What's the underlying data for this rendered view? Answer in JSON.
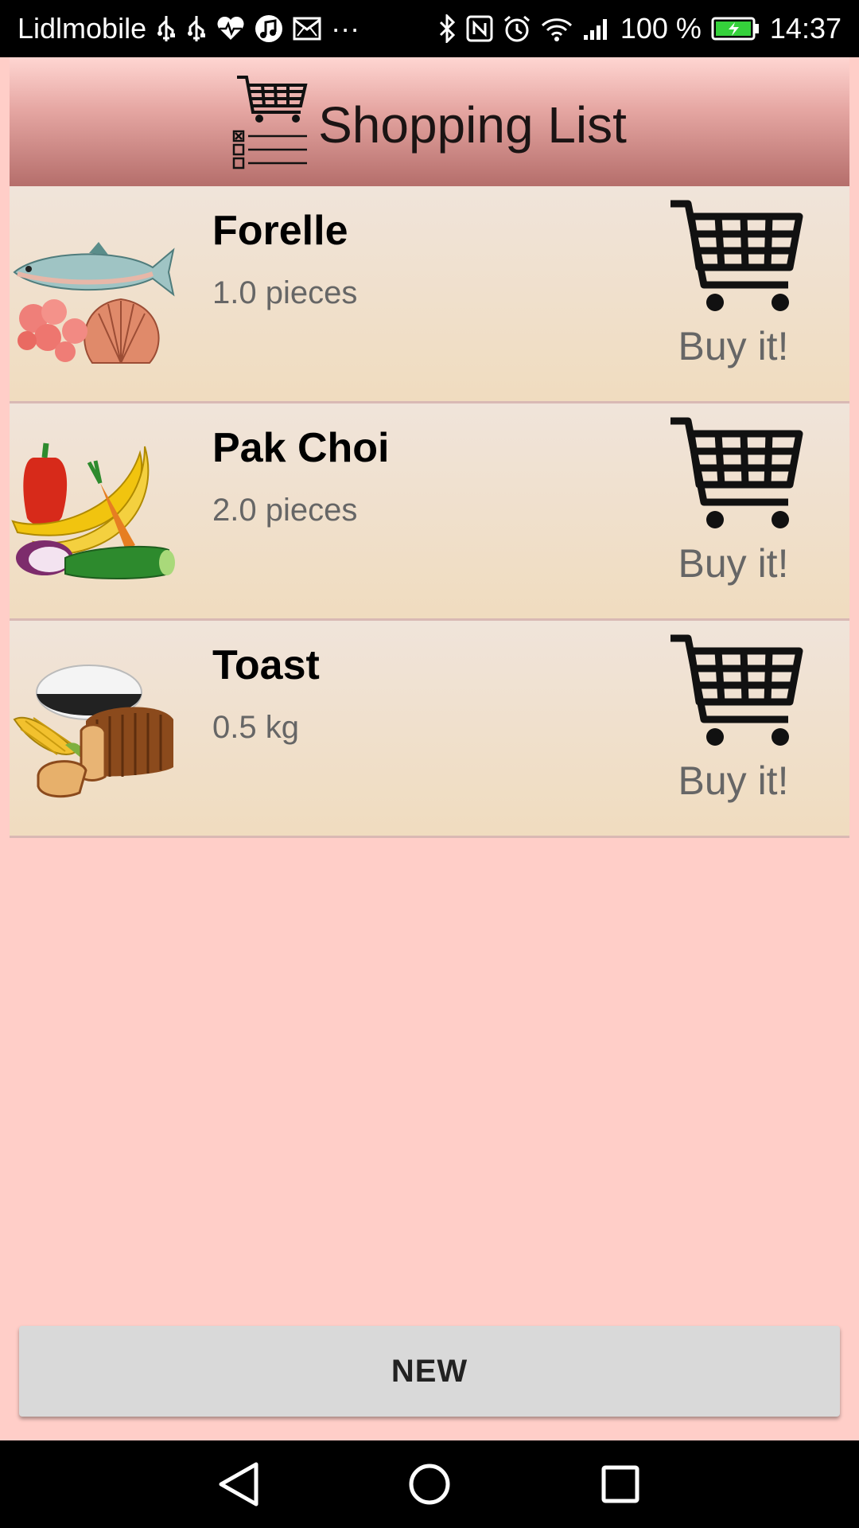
{
  "status_bar": {
    "carrier": "Lidlmobile",
    "more": "···",
    "battery_percent": "100 %",
    "time": "14:37",
    "icons": [
      "usb-icon",
      "usb-icon",
      "health-icon",
      "music-icon",
      "mail-icon",
      "bluetooth-icon",
      "nfc-icon",
      "alarm-icon",
      "wifi-icon",
      "signal-icon",
      "battery-charging-icon"
    ]
  },
  "header": {
    "title": "Shopping List",
    "icon": "shopping-list-cart-icon"
  },
  "items": [
    {
      "name": "Forelle",
      "quantity": "1.0 pieces",
      "image": "seafood-image",
      "buy_label": "Buy it!"
    },
    {
      "name": "Pak Choi",
      "quantity": "2.0 pieces",
      "image": "vegetables-image",
      "buy_label": "Buy it!"
    },
    {
      "name": "Toast",
      "quantity": "0.5 kg",
      "image": "bread-grains-image",
      "buy_label": "Buy it!"
    }
  ],
  "new_button": {
    "label": "NEW"
  },
  "nav": {
    "buttons": [
      "back",
      "home",
      "recents"
    ]
  },
  "colors": {
    "background": "#ffcec8",
    "header_top": "#ffd6d2",
    "header_bottom": "#b56e6b",
    "item_top": "#f0e4da",
    "item_bottom": "#f0dcbf",
    "muted_text": "#666666"
  }
}
